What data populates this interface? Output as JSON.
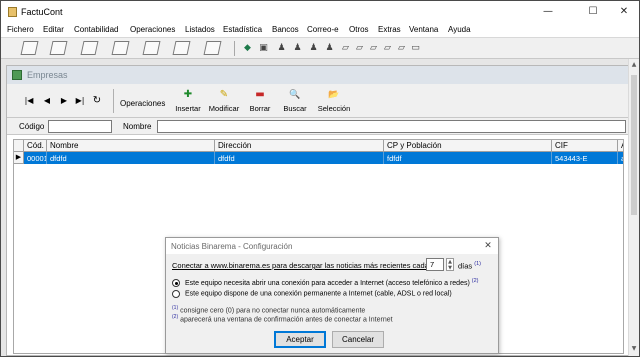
{
  "window": {
    "title": "FactuCont",
    "minimize": "—",
    "maximize": "☐",
    "close": "✕"
  },
  "menu": [
    "Fichero",
    "Editar",
    "Contabilidad",
    "Operaciones",
    "Listados",
    "Estadística",
    "Bancos",
    "Correo-e",
    "Otros",
    "Extras",
    "Ventana",
    "Ayuda"
  ],
  "toolbar": {
    "big_icons": [
      "new-doc-icon",
      "printer-icon",
      "edit-doc-icon",
      "shapes-icon",
      "chart-icon",
      "tools-icon",
      "undo-icon"
    ],
    "small_icons": [
      "cube-icon",
      "box-icon",
      "person-icon",
      "person-icon",
      "person-icon",
      "person-icon",
      "document-icon",
      "document-icon",
      "document-icon",
      "document-icon",
      "document-icon",
      "document-icon",
      "document-icon",
      "truck-icon"
    ]
  },
  "empresas": {
    "title": "Empresas",
    "nav": {
      "first": "|◀",
      "prev": "◀",
      "next": "▶",
      "last": "▶|",
      "refresh": "↻"
    },
    "operaciones_label": "Operaciones",
    "ops": [
      {
        "label": "Insertar",
        "icon": "✚",
        "color": "#1f8a2c"
      },
      {
        "label": "Modificar",
        "icon": "✎",
        "color": "#c9a200"
      },
      {
        "label": "Borrar",
        "icon": "▬",
        "color": "#c62828"
      },
      {
        "label": "Buscar",
        "icon": "🔍",
        "color": "#1c4fa8"
      },
      {
        "label": "Selección",
        "icon": "📂",
        "color": "#d4a91a"
      }
    ],
    "search": {
      "codigo_label": "Código",
      "codigo_value": "",
      "nombre_label": "Nombre",
      "nombre_value": ""
    },
    "grid": {
      "headers": [
        "Cód.",
        "Nombre",
        "Dirección",
        "CP y Población",
        "CIF",
        "A"
      ],
      "rows": [
        {
          "indicator": "▶",
          "cells": [
            "00001",
            "dfdfd",
            "dfdfd",
            "fdfdf",
            "543443-E",
            "ar"
          ]
        }
      ]
    }
  },
  "dialog": {
    "title": "Noticias Binarema - Configuración",
    "close": "✕",
    "connect_text": "Conectar a www.binarema.es para descargar las noticias más recientes cada",
    "days_value": "7",
    "days_label": "días",
    "sup1": "(1)",
    "sup2": "(2)",
    "option1": "Este equipo necesita abrir una conexión para acceder a Internet (acceso telefónico a redes)",
    "option2": "Este equipo dispone de una conexión permanente a Internet (cable, ADSL o red local)",
    "note1": "consigne cero (0) para no conectar nunca automáticamente",
    "note2": "aparecerá una ventana de confirmación antes de conectar a Internet",
    "accept": "Aceptar",
    "cancel": "Cancelar"
  }
}
